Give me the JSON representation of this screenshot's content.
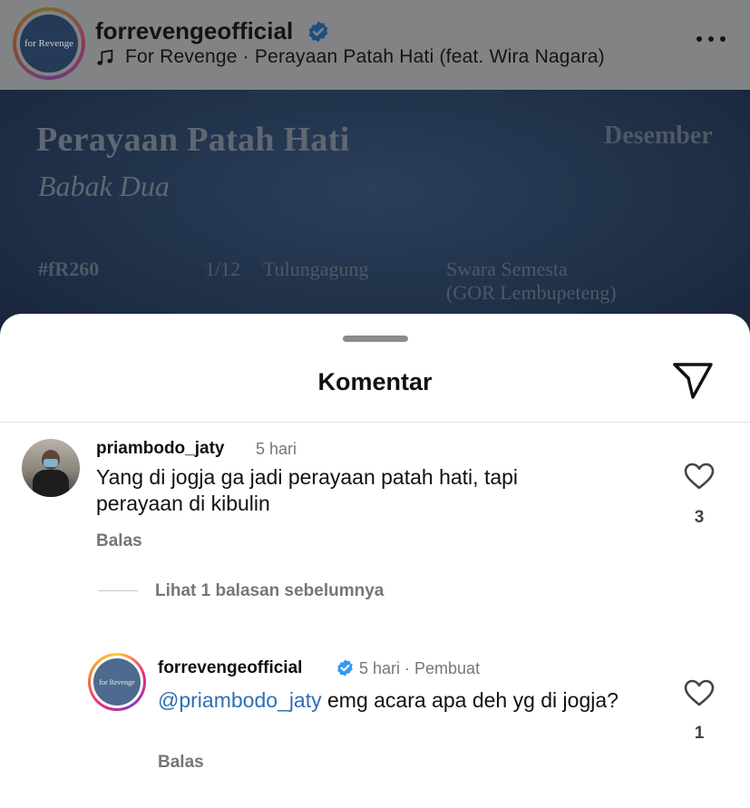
{
  "post": {
    "username": "forrevengeofficial",
    "verified": true,
    "song": "For Revenge · Perayaan Patah Hati (feat. Wira Nagara)",
    "avatar_text": "for Revenge",
    "image": {
      "title": "Perayaan Patah Hati",
      "subtitle": "Babak Dua",
      "month": "Desember",
      "tag": "#fR260",
      "number": "1/12",
      "city": "Tulungagung",
      "venue_line1": "Swara Semesta",
      "venue_line2": "(GOR Lembupeteng)"
    }
  },
  "sheet": {
    "title": "Komentar"
  },
  "comments": [
    {
      "username": "priambodo_jaty",
      "time": "5 hari",
      "text": "Yang di jogja ga jadi perayaan patah hati, tapi perayaan di kibulin",
      "reply_label": "Balas",
      "likes": "3"
    }
  ],
  "view_replies": "Lihat 1 balasan sebelumnya",
  "reply": {
    "username": "forrevengeofficial",
    "verified": true,
    "avatar_text": "for Revenge",
    "meta": "5 hari · Pembuat",
    "mention": "@priambodo_jaty",
    "text": " emg acara apa deh yg di jogja?",
    "reply_label": "Balas",
    "likes": "1"
  },
  "colors": {
    "verified_blue": "#3797f0",
    "mention_blue": "#2f6fb4",
    "muted_text": "#767676",
    "overlay_gray": "#818385"
  },
  "icons": [
    "verified-badge-icon",
    "music-note-icon",
    "more-options-icon",
    "send-icon",
    "heart-icon"
  ]
}
